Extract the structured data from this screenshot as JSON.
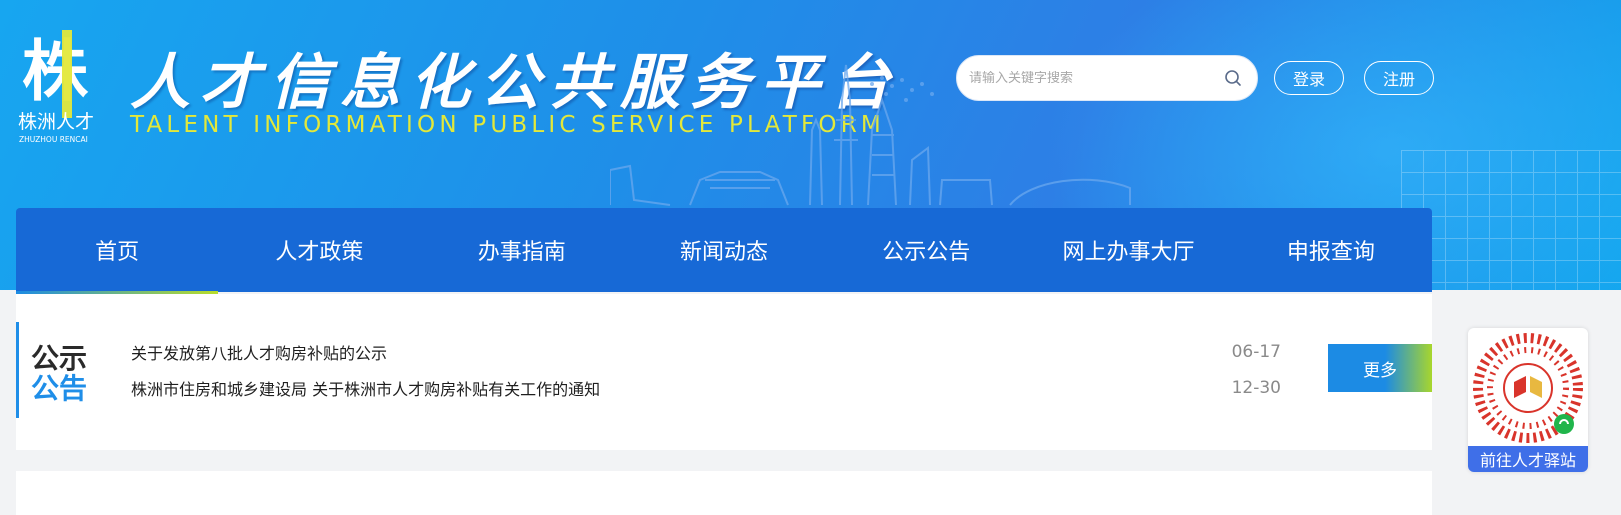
{
  "brand": {
    "logo_char": "株",
    "logo_cn": "株洲人才",
    "logo_en": "ZHUZHOU RENCAI",
    "title": "人才信息化公共服务平台",
    "subtitle": "TALENT INFORMATION PUBLIC SERVICE PLATFORM"
  },
  "search": {
    "placeholder": "请输入关键字搜索",
    "icon": "search-icon"
  },
  "auth": {
    "login_label": "登录",
    "register_label": "注册"
  },
  "nav": {
    "items": [
      {
        "label": "首页",
        "active": true
      },
      {
        "label": "人才政策",
        "active": false
      },
      {
        "label": "办事指南",
        "active": false
      },
      {
        "label": "新闻动态",
        "active": false
      },
      {
        "label": "公示公告",
        "active": false
      },
      {
        "label": "网上办事大厅",
        "active": false
      },
      {
        "label": "申报查询",
        "active": false
      }
    ]
  },
  "notice": {
    "label_line1": "公示",
    "label_line2": "公告",
    "items": [
      {
        "title": "关于发放第八批人才购房补贴的公示",
        "date": "06-17"
      },
      {
        "title": "株洲市住房和城乡建设局 关于株洲市人才购房补贴有关工作的通知",
        "date": "12-30"
      }
    ],
    "more_label": "更多"
  },
  "float_qr": {
    "caption": "前往人才驿站"
  },
  "colors": {
    "header_blue": "#1f8ee8",
    "nav_blue": "#1769d6",
    "accent_green": "#a8d62c",
    "subtitle_yellow": "#e3e83a",
    "qr_caption_bg": "#3f6fe8"
  }
}
